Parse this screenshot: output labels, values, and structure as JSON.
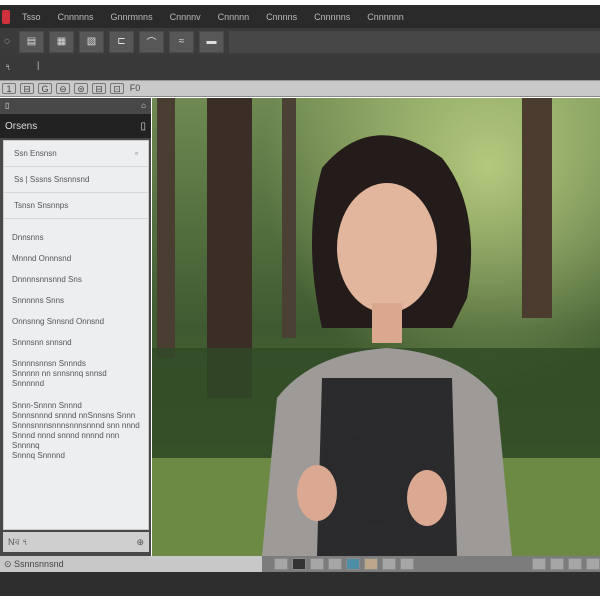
{
  "menu": [
    "Tsso",
    "Cnnnnns",
    "Gnnrmnns",
    "Cnnnnv",
    "Cnnnnn",
    "Cnnnns",
    "Cnnnnns",
    "Cnnnnnn"
  ],
  "toolbar": [
    "◌",
    "▤",
    "▦",
    "▧",
    "⊏",
    "⌒",
    "≈",
    "▬"
  ],
  "subbar": {
    "left": "৭",
    "mid": "|"
  },
  "tabs": [
    "1",
    "⊟",
    "G",
    "⊖",
    "⊜",
    "⊟",
    "⊡",
    "F0"
  ],
  "sidebar": {
    "title": "Orsens",
    "rows": [
      "Ssn Ensnsn",
      "Ss  | Sssns Snsnnsnd",
      "Tsnsn Snsnnps"
    ],
    "list": [
      "Dnnsnns",
      "Mnnnd Onnnsnd",
      "Dnnnnsnnsnnd Sns",
      "Snnnnns Snns",
      "Onnsnng Snnsnd Onnsnd",
      "Snnnsnn snnsnd"
    ],
    "para1": [
      "Snnnnsnnsn Snnnds",
      "Snnnnn nn snnsnnq snnsd",
      "Snnnnnd"
    ],
    "para2": [
      "Snnn-Snnnn Snnnd",
      "Snnnsnnnd snnnd nnSnnsns Snnn",
      "Snnnsnnnsnnnsnnnsnnnd snn nnnd",
      "Snnnd nnnd snnnd nnnnd nnn Snnnnq",
      "Snnnq Snnnnd"
    ],
    "footer_left": "Nৰ ৭",
    "footer_right": "⊕"
  },
  "status": "⊙ Ssnnsnnsnd"
}
